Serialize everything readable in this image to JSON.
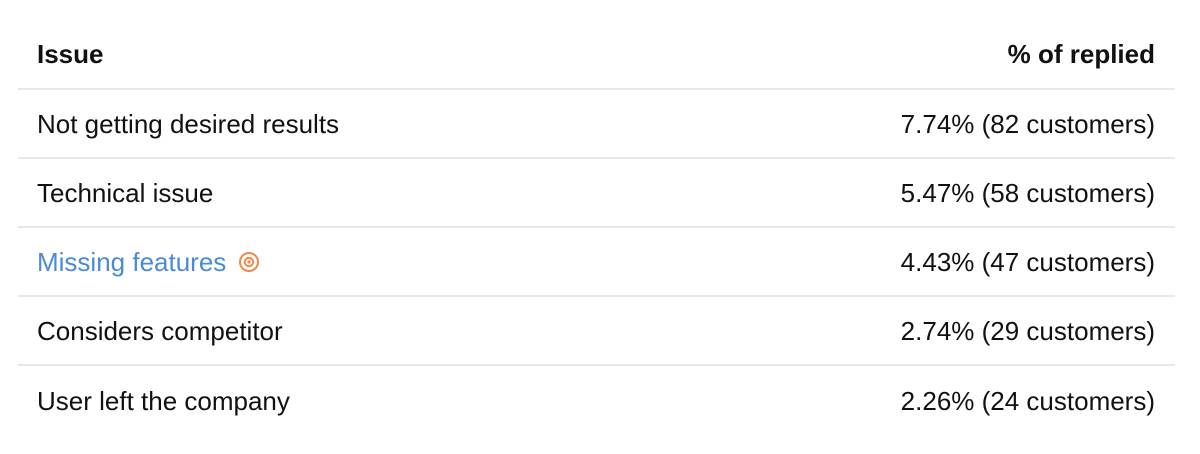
{
  "table": {
    "headers": {
      "issue": "Issue",
      "percent": "% of replied"
    },
    "rows": [
      {
        "issue": "Not getting desired results",
        "value": "7.74% (82 customers)"
      },
      {
        "issue": "Technical issue",
        "value": "5.47% (58 customers)"
      },
      {
        "issue": "Missing features",
        "value": "4.43% (47 customers)",
        "link": true,
        "icon": "target-icon"
      },
      {
        "issue": "Considers competitor",
        "value": "2.74% (29 customers)"
      },
      {
        "issue": "User left the company",
        "value": "2.26% (24 customers)"
      }
    ]
  },
  "colors": {
    "link": "#4a8ad6",
    "icon": "#f08a4b",
    "divider": "#e8e8e8"
  }
}
